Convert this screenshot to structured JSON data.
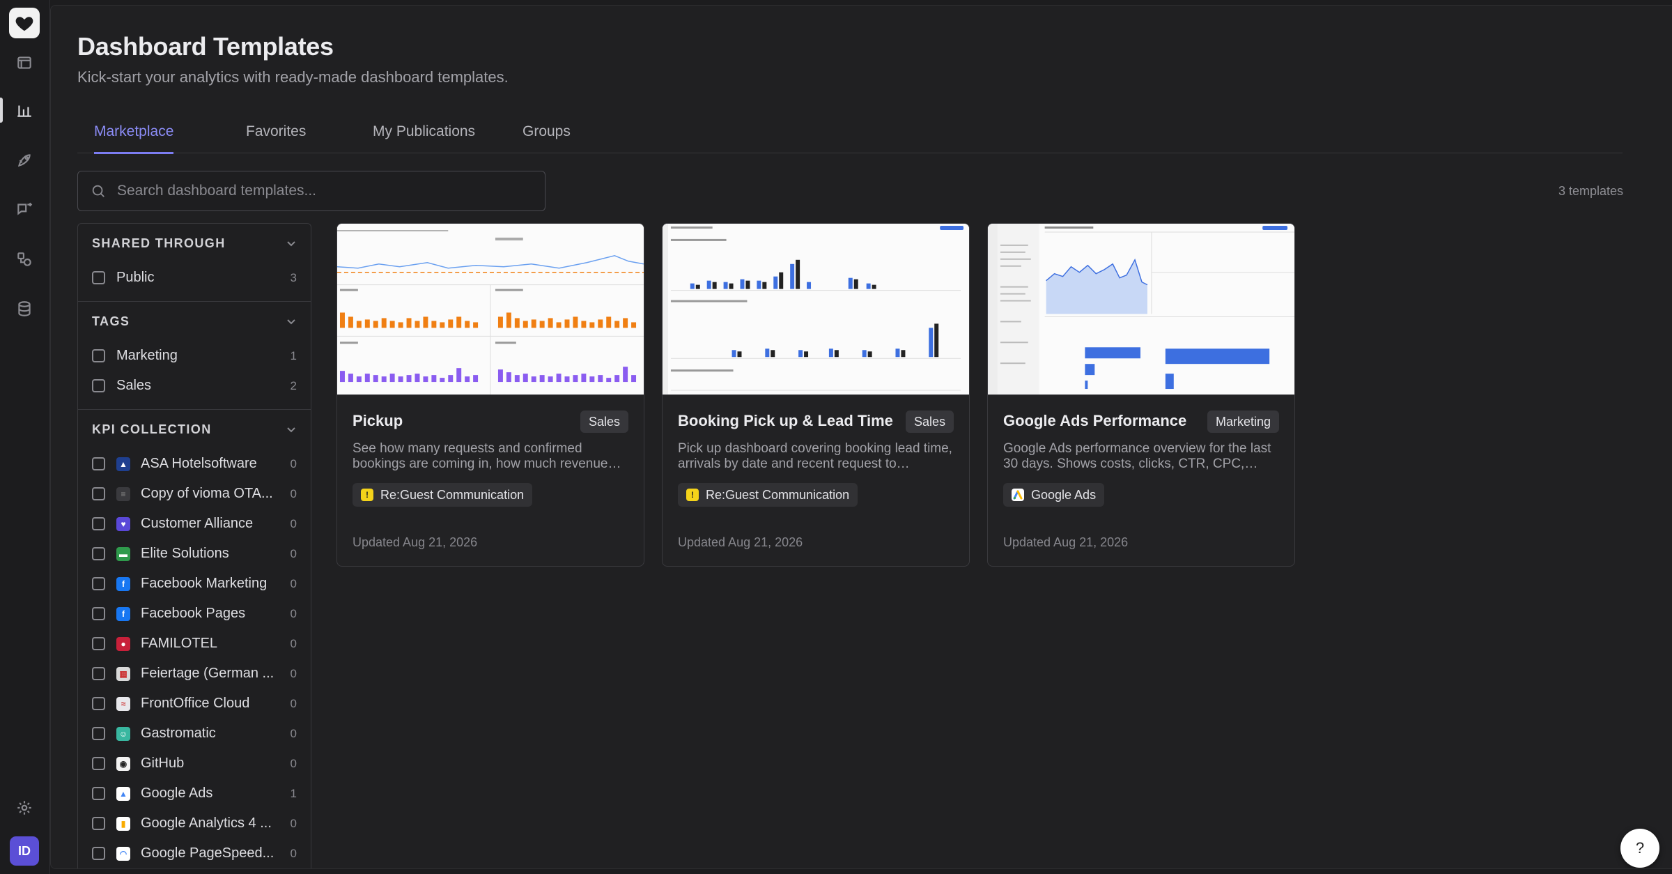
{
  "header": {
    "title": "Dashboard Templates",
    "subtitle": "Kick-start your analytics with ready-made dashboard templates."
  },
  "tabs": [
    {
      "label": "Marketplace",
      "active": true
    },
    {
      "label": "Favorites",
      "active": false
    },
    {
      "label": "My Publications",
      "active": false
    },
    {
      "label": "Groups",
      "active": false
    }
  ],
  "search": {
    "placeholder": "Search dashboard templates..."
  },
  "template_count": "3 templates",
  "filters": {
    "shared": {
      "title": "SHARED THROUGH",
      "items": [
        {
          "label": "Public",
          "count": "3"
        }
      ]
    },
    "tags": {
      "title": "TAGS",
      "items": [
        {
          "label": "Marketing",
          "count": "1"
        },
        {
          "label": "Sales",
          "count": "2"
        }
      ]
    },
    "kpi": {
      "title": "KPI COLLECTION",
      "items": [
        {
          "label": "ASA Hotelsoftware",
          "count": "0",
          "icon": "asa-icon",
          "color": "#1f3f8f"
        },
        {
          "label": "Copy of vioma OTA...",
          "count": "0",
          "icon": "database-icon",
          "color": "#3a3a3e"
        },
        {
          "label": "Customer Alliance",
          "count": "0",
          "icon": "customer-alliance-icon",
          "color": "#5a48d8"
        },
        {
          "label": "Elite Solutions",
          "count": "0",
          "icon": "elite-solutions-icon",
          "color": "#2f9a4c"
        },
        {
          "label": "Facebook Marketing",
          "count": "0",
          "icon": "facebook-icon",
          "color": "#1877f2"
        },
        {
          "label": "Facebook Pages",
          "count": "0",
          "icon": "facebook-icon",
          "color": "#1877f2"
        },
        {
          "label": "FAMILOTEL",
          "count": "0",
          "icon": "familotel-icon",
          "color": "#c8203a"
        },
        {
          "label": "Feiertage (German ...",
          "count": "0",
          "icon": "calendar-icon",
          "color": "#d9d9d9"
        },
        {
          "label": "FrontOffice Cloud",
          "count": "0",
          "icon": "frontoffice-icon",
          "color": "#e8e8ec"
        },
        {
          "label": "Gastromatic",
          "count": "0",
          "icon": "gastromatic-icon",
          "color": "#39b7a0"
        },
        {
          "label": "GitHub",
          "count": "0",
          "icon": "github-icon",
          "color": "#f2f2f2"
        },
        {
          "label": "Google Ads",
          "count": "1",
          "icon": "google-ads-icon",
          "color": "#ffffff"
        },
        {
          "label": "Google Analytics 4 ...",
          "count": "0",
          "icon": "google-analytics-icon",
          "color": "#ffffff"
        },
        {
          "label": "Google PageSpeed...",
          "count": "0",
          "icon": "pagespeed-icon",
          "color": "#ffffff"
        }
      ]
    }
  },
  "cards": [
    {
      "title": "Pickup",
      "tag": "Sales",
      "description": "See how many requests and confirmed bookings are coming in, how much revenue…",
      "integration": "Re:Guest Communication",
      "updated": "Updated Aug 21, 2026"
    },
    {
      "title": "Booking Pick up & Lead Time",
      "tag": "Sales",
      "description": "Pick up dashboard covering booking lead time, arrivals by date and recent request to…",
      "integration": "Re:Guest Communication",
      "updated": "Updated Aug 21, 2026"
    },
    {
      "title": "Google Ads Performance",
      "tag": "Marketing",
      "description": "Google Ads performance overview for the last 30 days. Shows costs, clicks, CTR, CPC,…",
      "integration": "Google Ads",
      "updated": "Updated Aug 21, 2026"
    }
  ],
  "user": {
    "initials": "ID"
  },
  "help": {
    "label": "?"
  },
  "colors": {
    "accent": "#7c7df2",
    "avatar": "#5b4fd6",
    "chart_orange": "#f07f13",
    "chart_blue": "#3d6fe0",
    "chart_purple": "#8a5cf0"
  }
}
